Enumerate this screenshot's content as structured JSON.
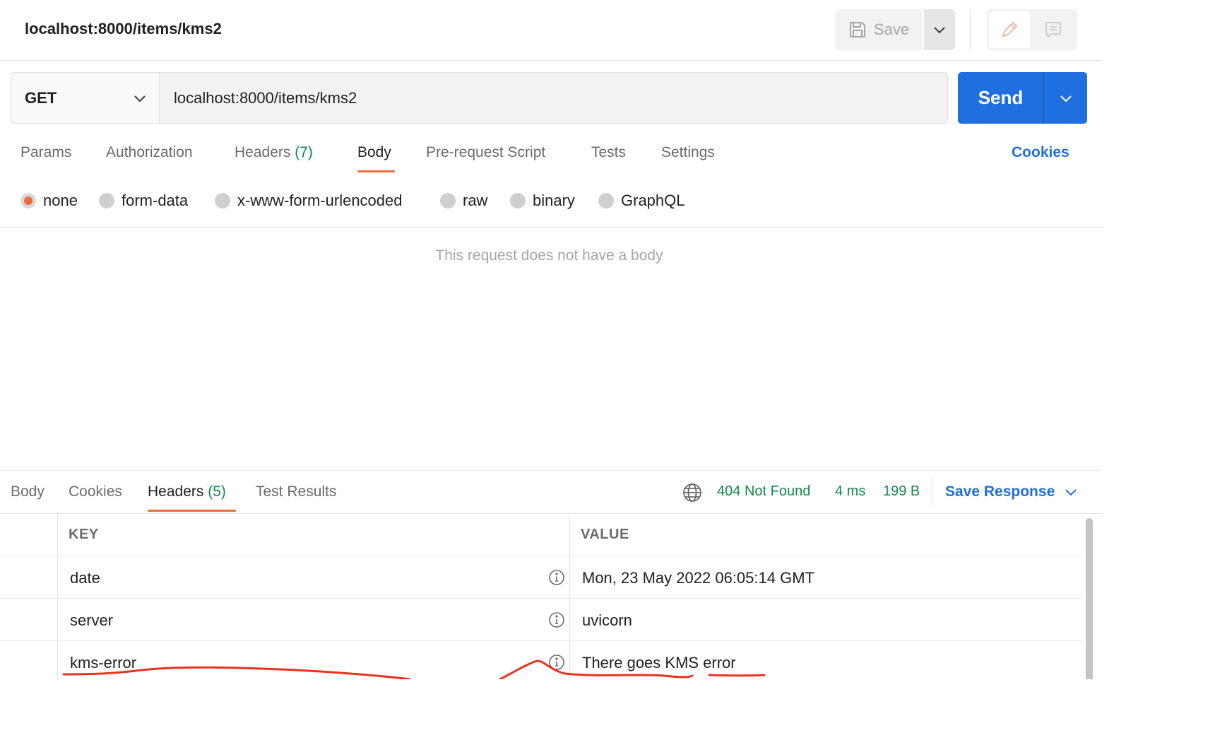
{
  "header": {
    "title": "localhost:8000/items/kms2",
    "save_label": "Save"
  },
  "request": {
    "method": "GET",
    "url": "localhost:8000/items/kms2",
    "send_label": "Send"
  },
  "request_tabs": {
    "params": "Params",
    "authorization": "Authorization",
    "headers": "Headers",
    "headers_count": "(7)",
    "body": "Body",
    "prerequest": "Pre-request Script",
    "tests": "Tests",
    "settings": "Settings",
    "cookies": "Cookies"
  },
  "body_types": {
    "none": "none",
    "form_data": "form-data",
    "urlencoded": "x-www-form-urlencoded",
    "raw": "raw",
    "binary": "binary",
    "graphql": "GraphQL",
    "selected": "none"
  },
  "body_empty_message": "This request does not have a body",
  "response": {
    "tabs": {
      "body": "Body",
      "cookies": "Cookies",
      "headers": "Headers",
      "headers_count": "(5)",
      "test_results": "Test Results"
    },
    "status_code": "404",
    "status_text": "Not Found",
    "time": "4 ms",
    "size": "199 B",
    "save_response": "Save Response",
    "table": {
      "key_header": "KEY",
      "value_header": "VALUE",
      "rows": [
        {
          "key": "date",
          "value": "Mon, 23 May 2022 06:05:14 GMT"
        },
        {
          "key": "server",
          "value": "uvicorn"
        },
        {
          "key": "kms-error",
          "value": "There goes KMS error"
        }
      ]
    }
  },
  "colors": {
    "accent_orange": "#f26b3a",
    "primary_blue": "#1f6fdf",
    "status_green": "#0f8a4b",
    "annotation_red": "#e8321e"
  }
}
